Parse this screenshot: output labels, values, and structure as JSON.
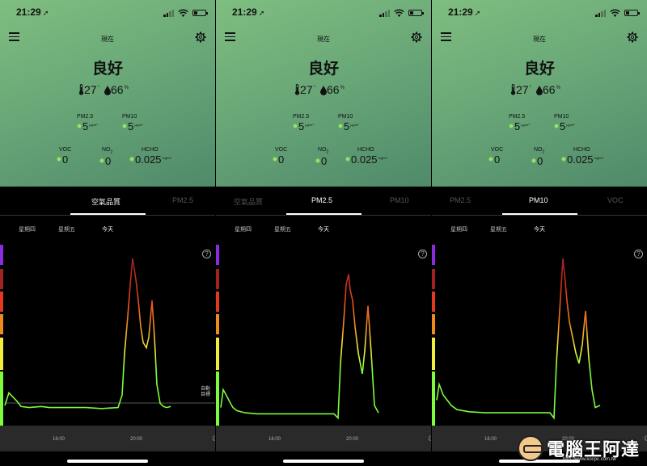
{
  "status": {
    "time": "21:29",
    "location_arrow": "➚"
  },
  "header": {
    "title": "現在",
    "quality": "良好",
    "temperature": "27",
    "temperature_unit": "°",
    "humidity": "66",
    "humidity_unit": "%"
  },
  "metrics": {
    "pm25": {
      "label": "PM2.5",
      "value": "5",
      "unit": "μg/m³"
    },
    "pm10": {
      "label": "PM10",
      "value": "5",
      "unit": "μg/m³"
    },
    "voc": {
      "label": "VOC",
      "value": "0"
    },
    "no2": {
      "label": "NO",
      "label_sub": "2",
      "value": "0"
    },
    "hcho": {
      "label": "HCHO",
      "value": "0.025",
      "unit": "mg/m³"
    }
  },
  "panels": [
    {
      "tabs": [
        {
          "label": ""
        },
        {
          "label": "空氣品質"
        },
        {
          "label": "PM2.5"
        }
      ],
      "active": 1
    },
    {
      "tabs": [
        {
          "label": "空氣品質"
        },
        {
          "label": "PM2.5"
        },
        {
          "label": "PM10"
        }
      ],
      "active": 1
    },
    {
      "tabs": [
        {
          "label": "PM2.5"
        },
        {
          "label": "PM10"
        },
        {
          "label": "VOC"
        }
      ],
      "active": 1
    }
  ],
  "days": {
    "thu": "星期四",
    "fri": "星期五",
    "today": "今天"
  },
  "help": "?",
  "target_label": [
    "自動",
    "目標"
  ],
  "axis": {
    "t1": "16:00",
    "t2": "20:00",
    "moon": "☾"
  },
  "colors": {
    "good": "#7cfc3a",
    "moderate": "#f2ef3a",
    "unhealthy_sensitive": "#f08a1c",
    "unhealthy": "#e23a1a",
    "very_unhealthy": "#a02222",
    "hazardous": "#8a2be2"
  },
  "chart_data": [
    {
      "type": "line",
      "series": [
        {
          "x": [
            0,
            5,
            10,
            15,
            20,
            30,
            45,
            55,
            70,
            85,
            100,
            120,
            140,
            145,
            148,
            152,
            155,
            158,
            162,
            165,
            168,
            171,
            175,
            178,
            182,
            185,
            188,
            192,
            196,
            200,
            205
          ],
          "values": [
            10,
            22,
            18,
            14,
            9,
            8,
            9,
            8,
            8,
            8,
            8,
            7,
            8,
            20,
            60,
            95,
            125,
            150,
            130,
            110,
            85,
            70,
            65,
            75,
            110,
            75,
            30,
            12,
            9,
            8,
            9
          ]
        }
      ]
    },
    {
      "type": "line",
      "series": [
        {
          "x": [
            0,
            3,
            8,
            12,
            15,
            20,
            30,
            45,
            60,
            80,
            100,
            120,
            140,
            145,
            148,
            152,
            155,
            158,
            160,
            163,
            166,
            170,
            175,
            178,
            182,
            186,
            190,
            195
          ],
          "values": [
            8,
            25,
            18,
            12,
            8,
            5,
            3,
            2,
            2,
            2,
            2,
            2,
            2,
            -2,
            50,
            90,
            125,
            135,
            120,
            110,
            85,
            60,
            40,
            62,
            105,
            60,
            10,
            3
          ]
        }
      ]
    },
    {
      "type": "line",
      "series": [
        {
          "x": [
            0,
            3,
            8,
            12,
            18,
            25,
            40,
            60,
            80,
            100,
            120,
            140,
            145,
            148,
            152,
            156,
            158,
            161,
            164,
            168,
            172,
            176,
            180,
            184,
            188,
            192,
            196,
            202
          ],
          "values": [
            15,
            30,
            20,
            16,
            10,
            6,
            4,
            3,
            3,
            3,
            3,
            3,
            -2,
            50,
            100,
            150,
            135,
            110,
            90,
            75,
            60,
            50,
            68,
            100,
            55,
            25,
            8,
            10
          ]
        }
      ]
    }
  ]
}
